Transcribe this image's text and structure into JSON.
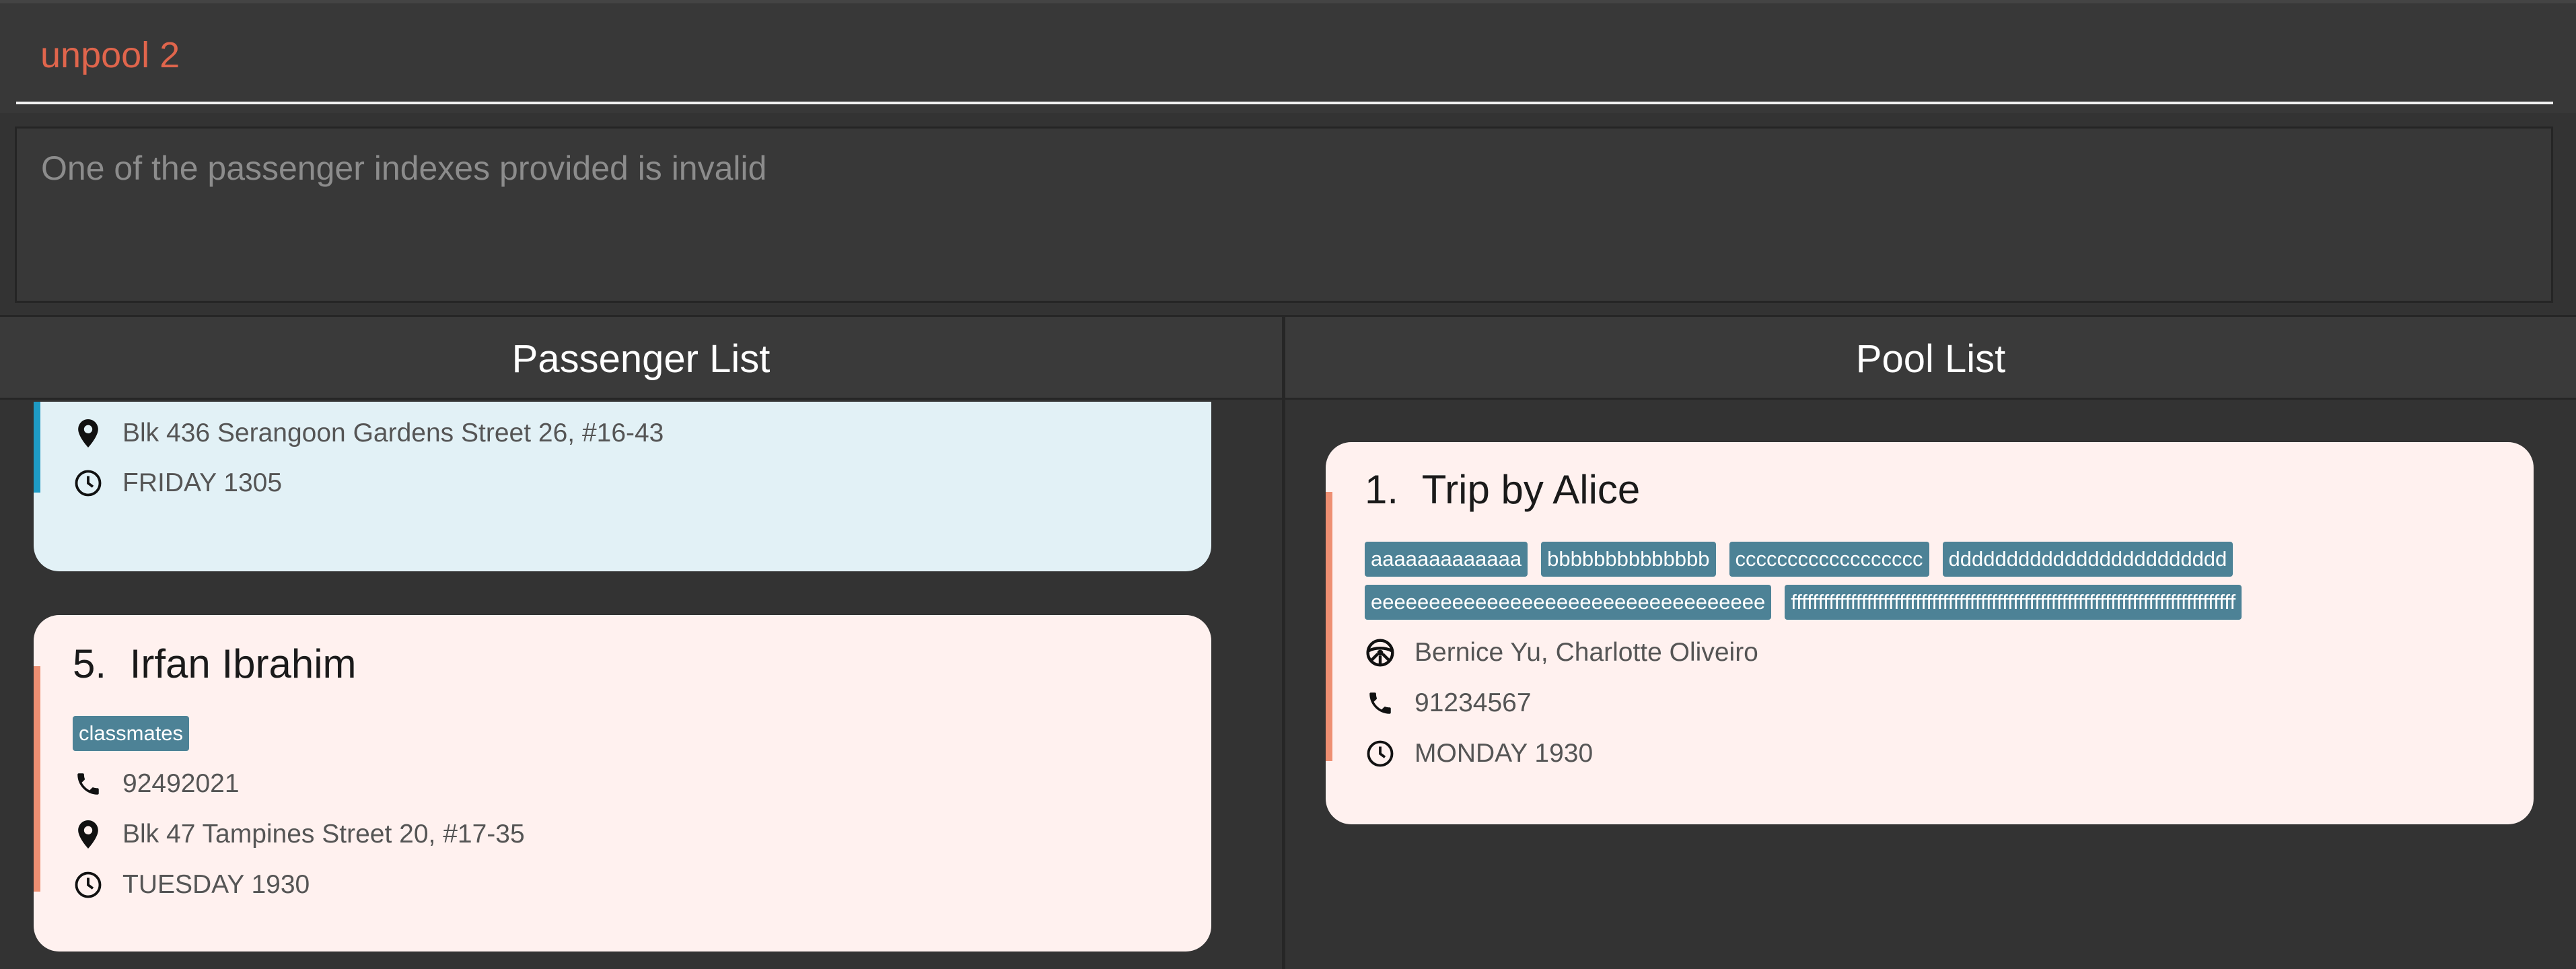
{
  "command": {
    "value": "unpool 2"
  },
  "result": {
    "message": "One of the passenger indexes provided is invalid"
  },
  "headers": {
    "passenger_list": "Passenger List",
    "pool_list": "Pool List"
  },
  "passengers": {
    "partial": {
      "address": "Blk 436 Serangoon Gardens Street 26, #16-43",
      "time": "FRIDAY 1305"
    },
    "card5": {
      "index": "5.",
      "name": "Irfan Ibrahim",
      "tags": [
        "classmates"
      ],
      "phone": "92492021",
      "address": "Blk 47 Tampines Street 20, #17-35",
      "time": "TUESDAY 1930"
    }
  },
  "pools": [
    {
      "index": "1.",
      "title": "Trip by Alice",
      "tags": [
        "aaaaaaaaaaaaa",
        "bbbbbbbbbbbbbb",
        "cccccccccccccccccc",
        "dddddddddddddddddddddddd",
        "eeeeeeeeeeeeeeeeeeeeeeeeeeeeeeeeee",
        "ffffffffffffffffffffffffffffffffffffffffffffffffffffffffffffffffffffffffffffffffff"
      ],
      "passengers": "Bernice Yu, Charlotte Oliveiro",
      "phone": "91234567",
      "time": "MONDAY 1930"
    }
  ],
  "colors": {
    "accent_red": "#e0654c",
    "passenger_selected_bg": "#e2f1f6",
    "card_bg": "#fff1ef",
    "tag_bg": "#4d8296"
  },
  "icons": [
    "location-icon",
    "clock-icon",
    "phone-icon",
    "steering-wheel-icon"
  ]
}
